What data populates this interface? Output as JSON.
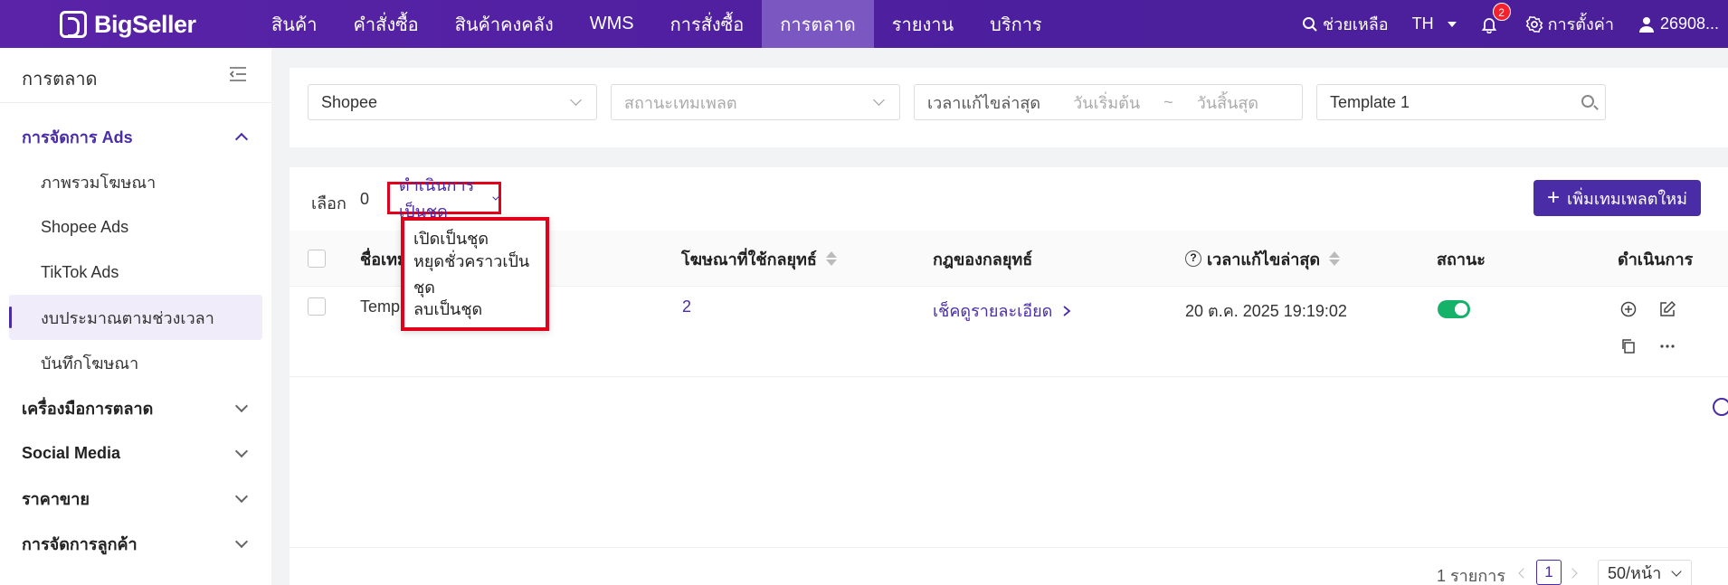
{
  "brand": {
    "name": "BigSeller"
  },
  "nav": {
    "items": [
      {
        "label": "สินค้า"
      },
      {
        "label": "คำสั่งซื้อ"
      },
      {
        "label": "สินค้าคงคลัง"
      },
      {
        "label": "WMS"
      },
      {
        "label": "การสั่งซื้อ"
      },
      {
        "label": "การตลาด"
      },
      {
        "label": "รายงาน"
      },
      {
        "label": "บริการ"
      }
    ],
    "active_index": 5
  },
  "top_right": {
    "help": "ช่วยเหลือ",
    "language": "TH",
    "notification_count": "2",
    "settings": "การตั้งค่า",
    "user": "26908..."
  },
  "sidebar": {
    "title": "การตลาด",
    "groups": [
      {
        "label": "การจัดการ Ads",
        "open": true
      },
      {
        "label": "เครื่องมือการตลาด"
      },
      {
        "label": "Social Media"
      },
      {
        "label": "ราคาขาย"
      },
      {
        "label": "การจัดการลูกค้า"
      }
    ],
    "sub_items": [
      {
        "label": "ภาพรวมโฆษณา"
      },
      {
        "label": "Shopee Ads"
      },
      {
        "label": "TikTok Ads"
      },
      {
        "label": "งบประมาณตามช่วงเวลา",
        "selected": true
      },
      {
        "label": "บันทึกโฆษณา"
      }
    ]
  },
  "filters": {
    "platform": "Shopee",
    "status_placeholder": "สถานะเทมเพลต",
    "date_label": "เวลาแก้ไขล่าสุด",
    "date_start": "วันเริ่มต้น",
    "date_sep": "~",
    "date_end": "วันสิ้นสุด",
    "search_value": "Template 1"
  },
  "toolbar": {
    "selected_label": "เลือก",
    "selected_count": "0",
    "batch_label": "ดำเนินการเป็นชุด",
    "add_label": "เพิ่มเทมเพลตใหม่"
  },
  "batch_menu": {
    "items": [
      {
        "label": "เปิดเป็นชุด"
      },
      {
        "label": "หยุดชั่วคราวเป็นชุด"
      },
      {
        "label": "ลบเป็นชุด"
      }
    ]
  },
  "table": {
    "headers": {
      "name": "ชื่อเทม",
      "ads": "โฆษณาที่ใช้กลยุทธ์",
      "rules": "กฎของกลยุทธ์",
      "updated": "เวลาแก้ไขล่าสุด",
      "status": "สถานะ",
      "actions": "ดำเนินการ"
    },
    "rows": [
      {
        "name": "Temp",
        "ads_count": "2",
        "rules_link": "เช็คดูรายละเอียด",
        "updated": "20 ต.ค. 2025 19:19:02",
        "status_on": true
      }
    ]
  },
  "pagination": {
    "total": "1 รายการ",
    "current": "1",
    "page_size": "50/หน้า"
  },
  "colors": {
    "primary": "#4a2ca6",
    "topbar": "#4f20a0",
    "highlight": "#e3001b",
    "toggle_on": "#17b26a"
  }
}
